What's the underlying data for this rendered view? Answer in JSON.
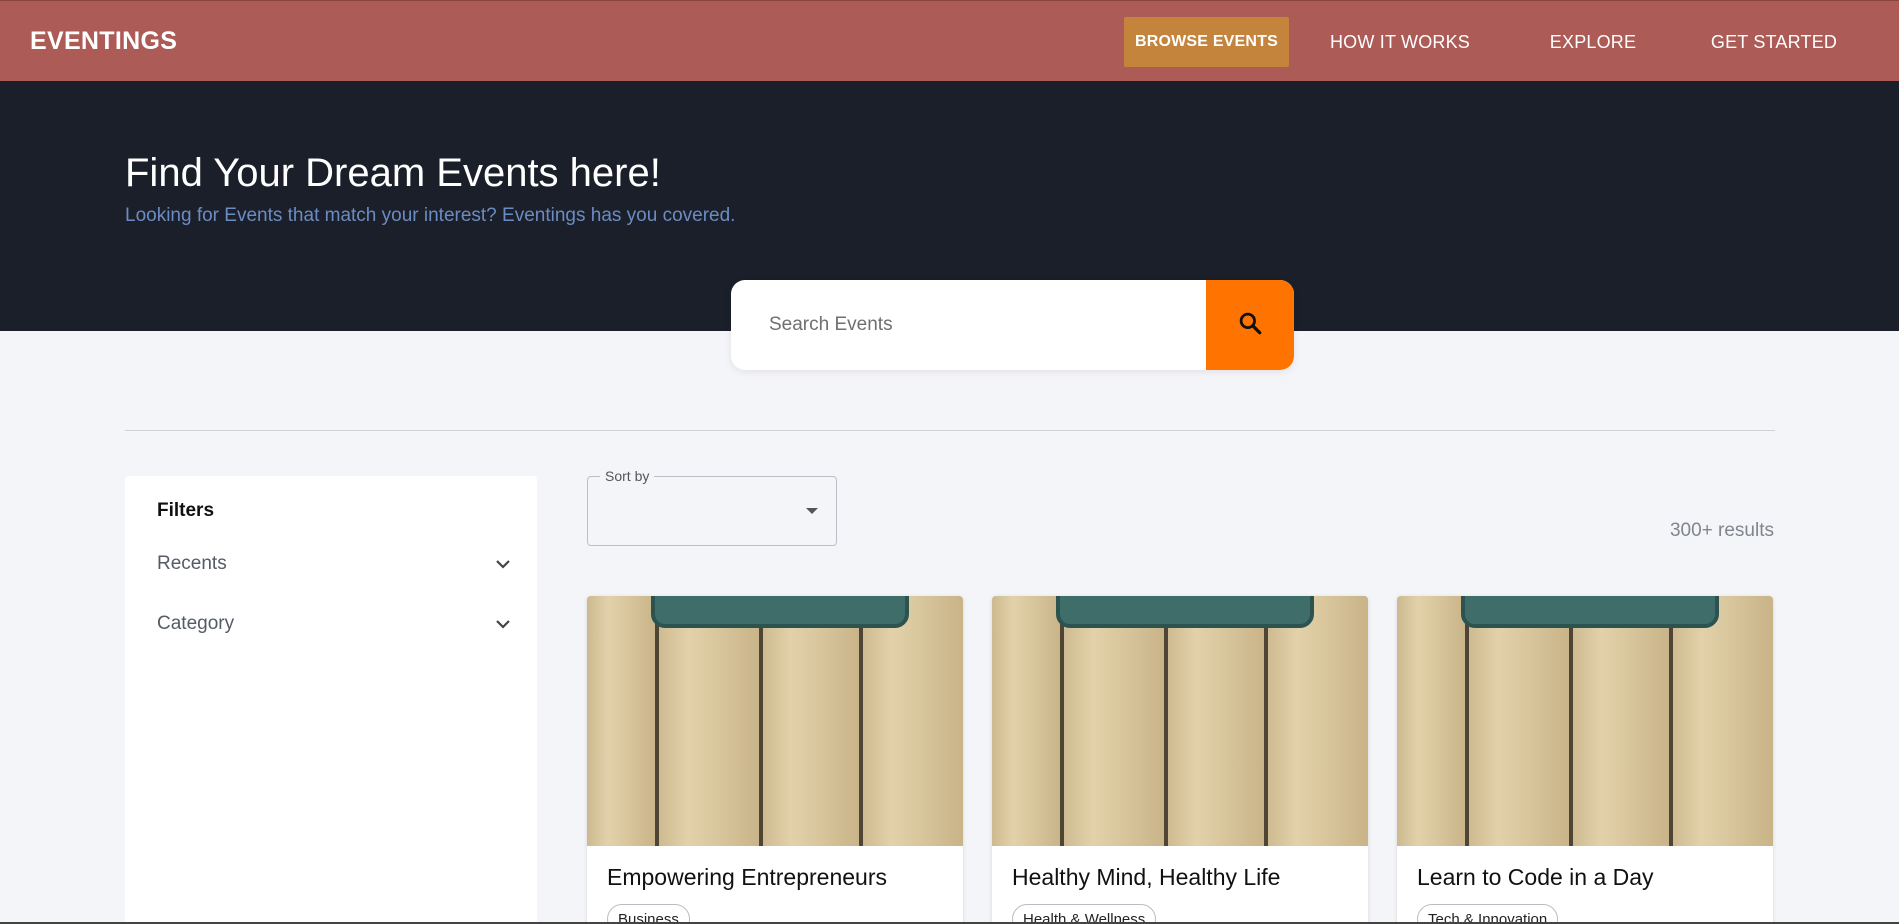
{
  "navbar": {
    "brand": "EVENTINGS",
    "links": [
      {
        "label": "BROWSE EVENTS"
      },
      {
        "label": "HOW IT WORKS"
      },
      {
        "label": "EXPLORE"
      },
      {
        "label": "GET STARTED"
      }
    ]
  },
  "hero": {
    "title": "Find Your Dream Events here!",
    "subtitle": "Looking for Events that match your interest? Eventings has you covered."
  },
  "search": {
    "placeholder": "Search Events",
    "icon": "search-icon"
  },
  "filters": {
    "title": "Filters",
    "items": [
      {
        "label": "Recents"
      },
      {
        "label": "Category"
      }
    ]
  },
  "sort": {
    "label": "Sort by",
    "value": ""
  },
  "results": {
    "count_text": "300+ results"
  },
  "events": [
    {
      "title": "Empowering Entrepreneurs",
      "category": "Business"
    },
    {
      "title": "Healthy Mind, Healthy Life",
      "category": "Health & Wellness"
    },
    {
      "title": "Learn to Code in a Day",
      "category": "Tech & Innovation"
    }
  ],
  "colors": {
    "navbar": "#ad5b56",
    "primary_button": "#c4843c",
    "hero": "#1b1f2a",
    "search_button": "#ff7300",
    "subtitle": "#6b8cc2"
  }
}
